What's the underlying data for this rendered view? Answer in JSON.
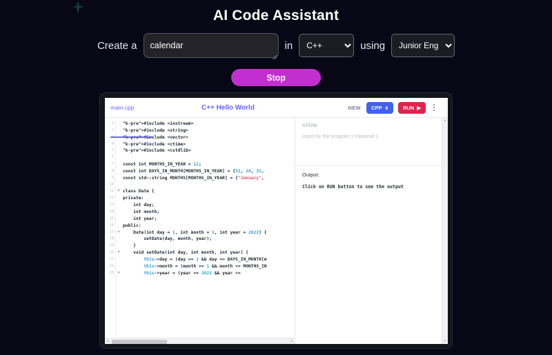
{
  "header": {
    "title": "AI Code Assistant"
  },
  "prompt": {
    "label_create": "Create a",
    "topic_value": "calendar",
    "topic_placeholder": "",
    "label_in": "in",
    "language_selected": "C++",
    "language_options": [
      "C++"
    ],
    "label_using": "using",
    "role_selected": "Junior Engineer",
    "role_options": [
      "Junior Engineer"
    ]
  },
  "action": {
    "stop_label": "Stop"
  },
  "editor": {
    "tab_file": "main.cpp",
    "title": "C++ Hello World",
    "new_label": "NEW",
    "lang_button": "CPP",
    "lang_caret": "∨",
    "run_label": "RUN",
    "run_caret": "▶",
    "line_numbers": [
      "1",
      "2",
      "3",
      "4",
      "5",
      "6",
      "7",
      "8",
      "9",
      "10",
      "11",
      "12",
      "13",
      "14",
      "15",
      "16",
      "17",
      "18",
      "19",
      "20",
      "21",
      "22",
      "23"
    ],
    "fold_markers": [
      "",
      "",
      "",
      "",
      "",
      "",
      "",
      "",
      "",
      "",
      "▾",
      "",
      "",
      "",
      "",
      "",
      "▾",
      "",
      "",
      "▾",
      "",
      "",
      "▾"
    ],
    "code_lines": [
      "#include <iostream>",
      "#include <string>",
      "#include <vector>",
      "#include <ctime>",
      "#include <cstdlib>",
      "",
      "const int MONTHS_IN_YEAR = 12;",
      "const int DAYS_IN_MONTH[MONTHS_IN_YEAR] = {31, 28, 31,",
      "const std::string MONTHS[MONTHS_IN_YEAR] = {\"January\",",
      "",
      "class Date {",
      "private:",
      "    int day;",
      "    int month;",
      "    int year;",
      "public:",
      "    Date(int day = 1, int month = 1, int year = 2022) {",
      "        setDate(day, month, year);",
      "    }",
      "    void setDate(int day, int month, int year) {",
      "        this->day = (day >= 1 && day <= DAYS_IN_MONTH[m",
      "        this->month = (month >= 1 && month <= MONTHS_IN",
      "        this->year = (year >= 2022 && year <="
    ]
  },
  "io": {
    "stdin_label": "STDIN",
    "stdin_placeholder": "Input for the program ( Optional )",
    "output_label": "Output:",
    "output_text": "Click on RUN button to see the output"
  },
  "scrollbars": {
    "h_left_arrow": "◂",
    "h_right_arrow": "▸",
    "v_up_arrow": "▴",
    "v_down_arrow": "▾"
  },
  "colors": {
    "background": "#070715",
    "stop_button": "#c22fd0",
    "cpp_button": "#4361ee",
    "run_button": "#e0234e",
    "accent_editor": "#6c63ff"
  }
}
